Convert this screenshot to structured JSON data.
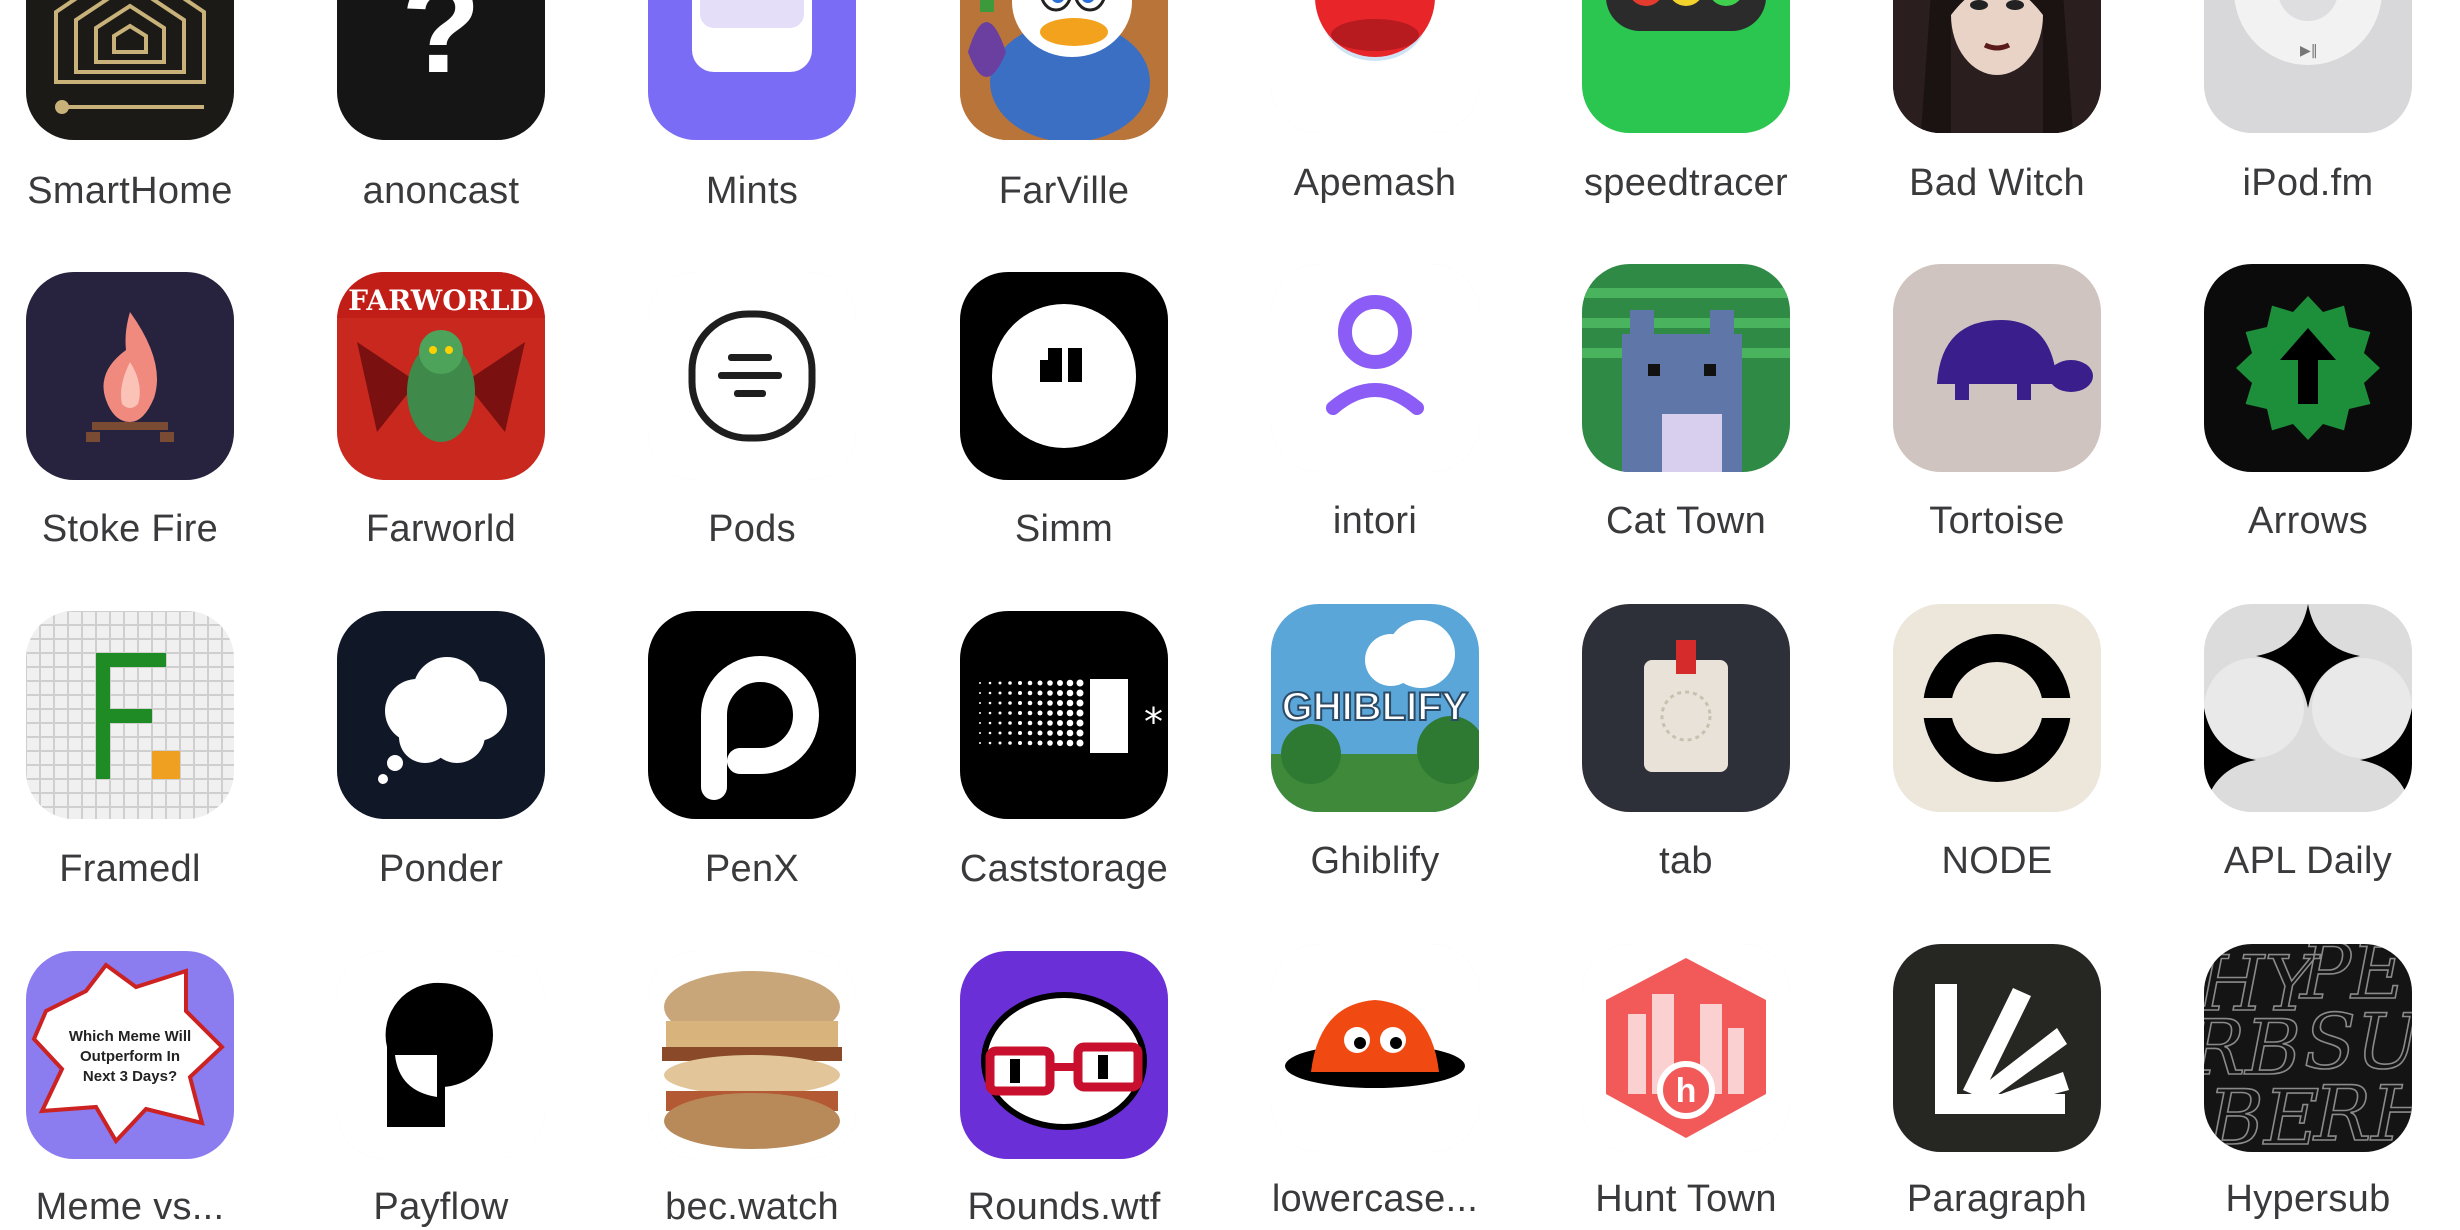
{
  "apps": [
    {
      "label": "SmartHome",
      "icon": "smarthome-icon",
      "bg": "#1c1a16"
    },
    {
      "label": "anoncast",
      "icon": "question-mark-icon",
      "bg": "#151515"
    },
    {
      "label": "Mints",
      "icon": "mints-card-icon",
      "bg": "#7b6cf6"
    },
    {
      "label": "FarVille",
      "icon": "farville-duck-icon",
      "bg": "#c9823c"
    },
    {
      "label": "Apemash",
      "icon": "red-button-icon",
      "bg": "#ffffff"
    },
    {
      "label": "speedtracer",
      "icon": "traffic-light-icon",
      "bg": "#2bc650"
    },
    {
      "label": "Bad Witch",
      "icon": "bad-witch-portrait-icon",
      "bg": "#3a2c2a"
    },
    {
      "label": "iPod.fm",
      "icon": "ipod-wheel-icon",
      "bg": "#d8d8da"
    },
    {
      "label": "Stoke Fire",
      "icon": "campfire-icon",
      "bg": "#27223d"
    },
    {
      "label": "Farworld",
      "icon": "dragon-icon",
      "bg": "#c8281e"
    },
    {
      "label": "Pods",
      "icon": "pods-bubble-icon",
      "bg": "#ffffff"
    },
    {
      "label": "Simm",
      "icon": "simm-circle-icon",
      "bg": "#000000"
    },
    {
      "label": "intori",
      "icon": "intori-person-icon",
      "bg": "#ffffff"
    },
    {
      "label": "Cat Town",
      "icon": "pixel-cat-icon",
      "bg": "#2f8a45"
    },
    {
      "label": "Tortoise",
      "icon": "tortoise-icon",
      "bg": "#cfc4bf"
    },
    {
      "label": "Arrows",
      "icon": "arrow-up-badge-icon",
      "bg": "#0b0b0b"
    },
    {
      "label": "Framedl",
      "icon": "pixel-f-icon",
      "bg": "#f0f0f0"
    },
    {
      "label": "Ponder",
      "icon": "thought-cloud-icon",
      "bg": "#101828"
    },
    {
      "label": "PenX",
      "icon": "penx-p-icon",
      "bg": "#000000"
    },
    {
      "label": "Caststorage",
      "icon": "caststorage-icon",
      "bg": "#000000"
    },
    {
      "label": "Ghiblify",
      "icon": "ghiblify-icon",
      "bg": "#5aa6d8",
      "icon_text": "GHIBLIFY"
    },
    {
      "label": "tab",
      "icon": "badge-tab-icon",
      "bg": "#2d3038"
    },
    {
      "label": "NODE",
      "icon": "node-ring-icon",
      "bg": "#ece6db"
    },
    {
      "label": "APL Daily",
      "icon": "four-point-star-icon",
      "bg": "#dcdcdc"
    },
    {
      "label": "Meme vs...",
      "icon": "meme-burst-icon",
      "bg": "#8b7cf0",
      "icon_text": "Which Meme Will Outperform In Next 3 Days?"
    },
    {
      "label": "Payflow",
      "icon": "payflow-shape-icon",
      "bg": "#ffffff"
    },
    {
      "label": "bec.watch",
      "icon": "sandwich-icon",
      "bg": "#ffffff"
    },
    {
      "label": "Rounds.wtf",
      "icon": "glasses-face-icon",
      "bg": "#6b2fd8"
    },
    {
      "label": "lowercase...",
      "icon": "orange-blob-icon",
      "bg": "#ffffff"
    },
    {
      "label": "Hunt Town",
      "icon": "hunt-town-icon",
      "bg": "#ffffff"
    },
    {
      "label": "Paragraph",
      "icon": "paragraph-rays-icon",
      "bg": "#262622"
    },
    {
      "label": "Hypersub",
      "icon": "hypersub-letters-icon",
      "bg": "#141414"
    }
  ]
}
